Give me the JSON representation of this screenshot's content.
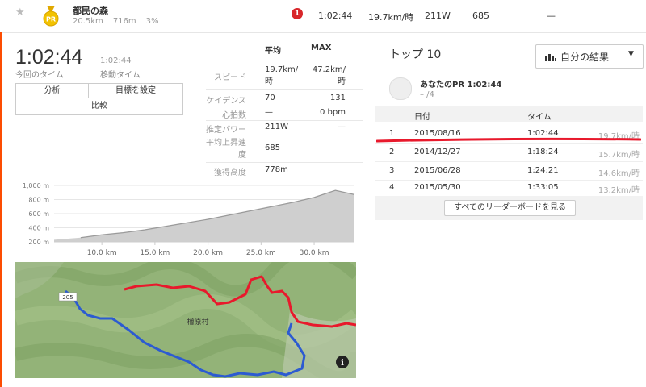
{
  "segment": {
    "star": "★",
    "medal_label": "PR",
    "name": "都民の森",
    "distance": "20.5km",
    "elevation": "716m",
    "grade": "3%",
    "rank": "1",
    "time": "1:02:44",
    "speed": "19.7km/時",
    "power": "211W",
    "elev_gain": "685",
    "dash": "—"
  },
  "summary": {
    "elapsed_time": "1:02:44",
    "elapsed_label": "今回のタイム",
    "moving_time": "1:02:44",
    "moving_label": "移動タイム"
  },
  "buttons": {
    "analysis": "分析",
    "set_goal": "目標を設定",
    "compare": "比較"
  },
  "stats": {
    "col_avg": "平均",
    "col_max": "MAX",
    "rows": [
      {
        "label": "スピード",
        "avg": "19.7km/時",
        "max": "47.2km/時"
      },
      {
        "label": "ケイデンス",
        "avg": "70",
        "max": "131"
      },
      {
        "label": "心拍数",
        "avg": "—",
        "max": "0 bpm"
      },
      {
        "label": "推定パワー",
        "avg": "211W",
        "max": "—"
      },
      {
        "label": "平均上昇速度",
        "avg": "685",
        "max": ""
      },
      {
        "label": "獲得高度",
        "avg": "778m",
        "max": ""
      }
    ]
  },
  "chart_data": {
    "type": "area",
    "title": "",
    "xlabel": "",
    "ylabel": "",
    "x_ticks": [
      "10.0 km",
      "15.0 km",
      "20.0 km",
      "25.0 km",
      "30.0 km"
    ],
    "y_ticks": [
      "1,000 m",
      "800 m",
      "600 m",
      "400 m",
      "200 m"
    ],
    "ylim": [
      200,
      1000
    ],
    "xlim": [
      5.5,
      33.8
    ],
    "x": [
      5.5,
      8,
      10,
      12,
      14,
      16,
      18,
      20,
      22,
      24,
      26,
      28,
      30,
      32,
      33.8
    ],
    "y": [
      230,
      260,
      300,
      330,
      370,
      420,
      470,
      520,
      580,
      640,
      700,
      760,
      830,
      930,
      870
    ],
    "highlight_x": [
      7.2,
      33.8
    ],
    "colors": {
      "area": "#cfcfcf",
      "highlight": "#9a9a9a"
    }
  },
  "map": {
    "village_label": "檜原村",
    "route_label": "205",
    "info_icon": "i",
    "colors": {
      "red_route": "#e8192c",
      "blue_route": "#2c5bd1",
      "terrain": "#8fb073"
    }
  },
  "leaderboard": {
    "title": "トップ 10",
    "filter_label": "自分の結果",
    "pr_label": "あなたのPR 1:02:44",
    "pr_rank": "– /4",
    "col_date": "日付",
    "col_time": "タイム",
    "rows": [
      {
        "rank": "1",
        "date": "2015/08/16",
        "time": "1:02:44",
        "speed": "19.7km/時"
      },
      {
        "rank": "2",
        "date": "2014/12/27",
        "time": "1:18:24",
        "speed": "15.7km/時"
      },
      {
        "rank": "3",
        "date": "2015/06/28",
        "time": "1:24:21",
        "speed": "14.6km/時"
      },
      {
        "rank": "4",
        "date": "2015/05/30",
        "time": "1:33:05",
        "speed": "13.2km/時"
      }
    ],
    "view_all": "すべてのリーダーボードを見る"
  }
}
